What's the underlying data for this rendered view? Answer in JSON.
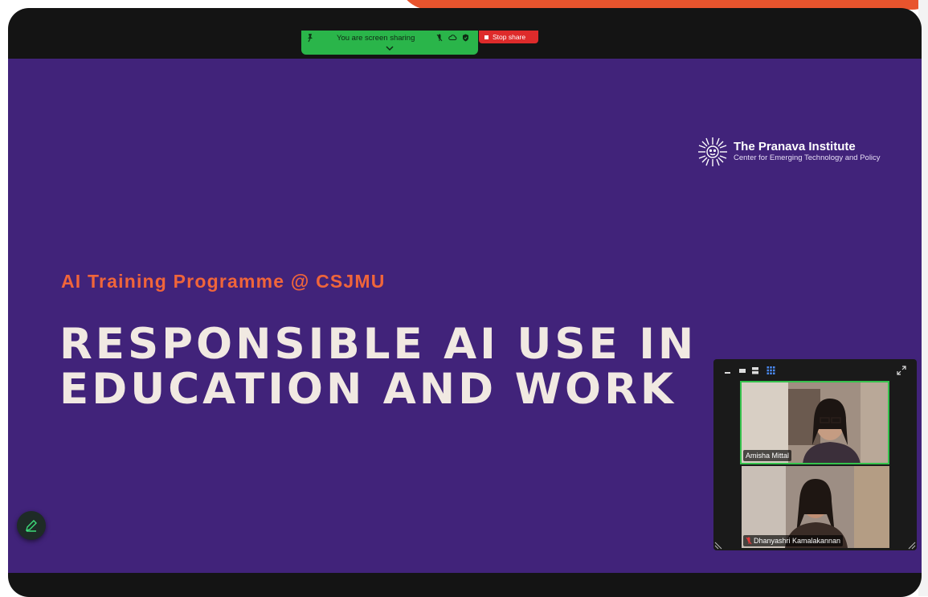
{
  "share_bar": {
    "status": "You are screen sharing",
    "stop_label": "Stop share"
  },
  "slide": {
    "brand_name": "The Pranava Institute",
    "brand_tagline": "Center for Emerging Technology and Policy",
    "subtitle": "AI Training Programme @ CSJMU",
    "title_line1": "RESPONSIBLE AI USE IN",
    "title_line2": "EDUCATION AND WORK"
  },
  "gallery": {
    "participants": [
      {
        "name": "Amisha Mittal",
        "active_speaker": true,
        "muted": false
      },
      {
        "name": "Dhanyashri Kamalakannan",
        "active_speaker": false,
        "muted": true
      }
    ]
  },
  "colors": {
    "slide_bg": "#41237a",
    "accent_orange": "#f0653a",
    "share_green": "#2ab54a",
    "stop_red": "#de2b2b",
    "title_cream": "#f1e9e2"
  },
  "icons": [
    "pin-icon",
    "mic-icon",
    "cloud-icon",
    "shield-icon",
    "chevron-down-icon",
    "stop-icon",
    "pencil-icon",
    "minimize-icon",
    "speaker-view-icon",
    "strip-view-icon",
    "gallery-view-icon",
    "expand-icon",
    "muted-mic-icon"
  ]
}
